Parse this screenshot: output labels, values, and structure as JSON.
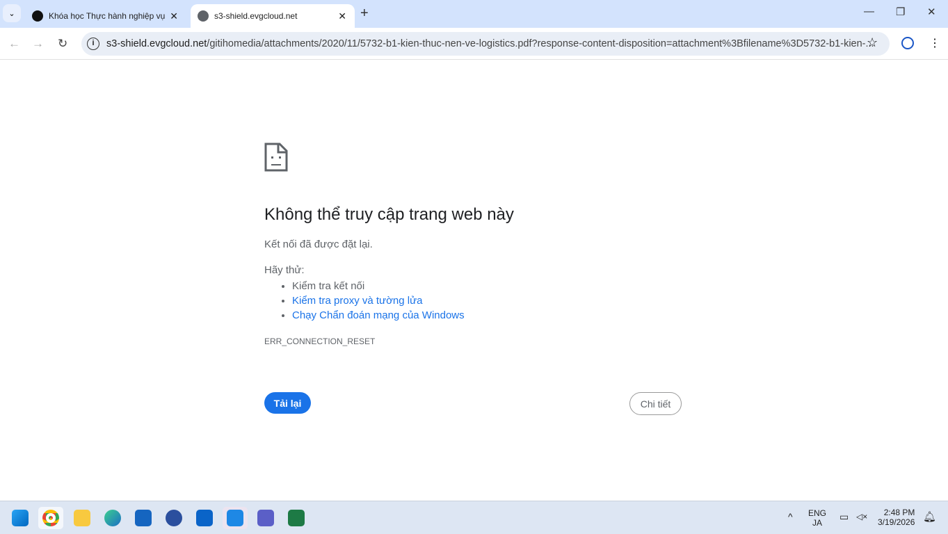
{
  "tabs": [
    {
      "label": "Khóa học Thực hành nghiệp vụ"
    },
    {
      "label": "s3-shield.evgcloud.net"
    }
  ],
  "address": {
    "host": "s3-shield.evgcloud.net",
    "path": "/gitihomedia/attachments/2020/11/5732-b1-kien-thuc-nen-ve-logistics.pdf?response-content-disposition=attachment%3Bfilename%3D5732-b1-kien-..."
  },
  "error": {
    "title": "Không thể truy cập trang web này",
    "message": "Kết nối đã được đặt lại.",
    "try_label": "Hãy thử:",
    "suggestions": [
      "Kiểm tra kết nối",
      "Kiểm tra proxy và tường lửa",
      "Chạy Chẩn đoán mạng của Windows"
    ],
    "code": "ERR_CONNECTION_RESET",
    "reload": "Tải lại",
    "details": "Chi tiết"
  },
  "taskbar": {
    "apps": [
      "start",
      "chrome",
      "file-explorer",
      "edge",
      "unikey",
      "app-s",
      "outlook",
      "zalo",
      "teams",
      "excel"
    ],
    "lang1": "ENG",
    "lang2": "JA",
    "time": "2:48 PM",
    "date": "3/19/2026"
  }
}
